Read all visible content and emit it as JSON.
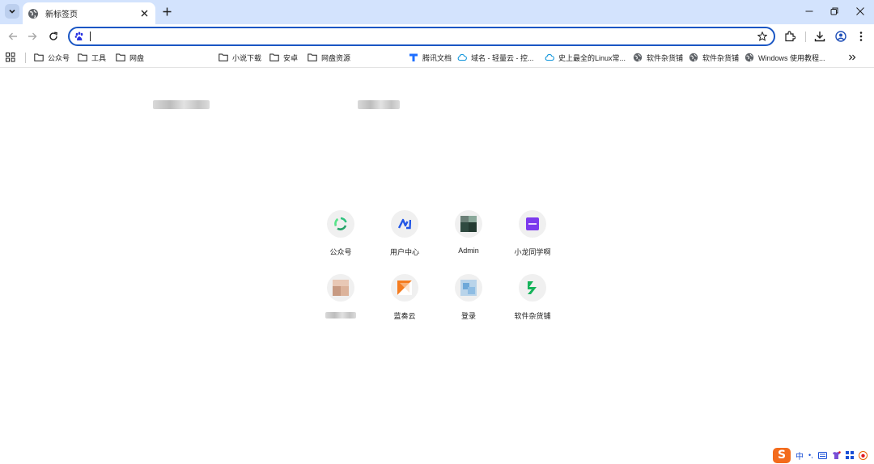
{
  "browser": {
    "tab": {
      "title": "新标签页"
    },
    "address_bar": {
      "value": "",
      "placeholder": ""
    }
  },
  "bookmarks": [
    {
      "label": "公众号",
      "icon": "folder-icon"
    },
    {
      "label": "工具",
      "icon": "folder-icon"
    },
    {
      "label": "网盘",
      "icon": "folder-icon"
    },
    {
      "label": "",
      "icon": "blurred",
      "redacted": true
    },
    {
      "label": "小说下载",
      "icon": "folder-icon"
    },
    {
      "label": "安卓",
      "icon": "folder-icon"
    },
    {
      "label": "网盘资源",
      "icon": "folder-icon"
    },
    {
      "label": "",
      "icon": "blurred",
      "redacted": true
    },
    {
      "label": "腾讯文档",
      "icon": "tencent-docs-icon"
    },
    {
      "label": "域名 - 轻量云 - 控...",
      "icon": "cloud-icon"
    },
    {
      "label": "史上最全的Linux常...",
      "icon": "cloud-icon"
    },
    {
      "label": "软件杂货铺",
      "icon": "globe-icon"
    },
    {
      "label": "软件杂货铺",
      "icon": "globe-icon"
    },
    {
      "label": "Windows 使用教程...",
      "icon": "globe-icon"
    }
  ],
  "shortcuts": [
    {
      "label": "公众号",
      "icon": "green-recycle-icon"
    },
    {
      "label": "用户中心",
      "icon": "blue-n-icon"
    },
    {
      "label": "Admin",
      "icon": "blurred-site-icon"
    },
    {
      "label": "小龙同学啊",
      "icon": "purple-square-icon"
    },
    {
      "label": "",
      "icon": "blurred-site-icon",
      "redacted": true
    },
    {
      "label": "蓝奏云",
      "icon": "lanzou-icon"
    },
    {
      "label": "登录",
      "icon": "blurred-site-icon"
    },
    {
      "label": "软件杂货铺",
      "icon": "green-s-icon"
    }
  ],
  "tray": {
    "ime_logo": "S",
    "ime_mode": "中",
    "punct": "•,"
  },
  "colors": {
    "tabstrip": "#d3e3fd",
    "omnibox_border": "#1a56c4",
    "shortcut_bg": "#f0f0f0",
    "sogou": "#f36b1c"
  }
}
